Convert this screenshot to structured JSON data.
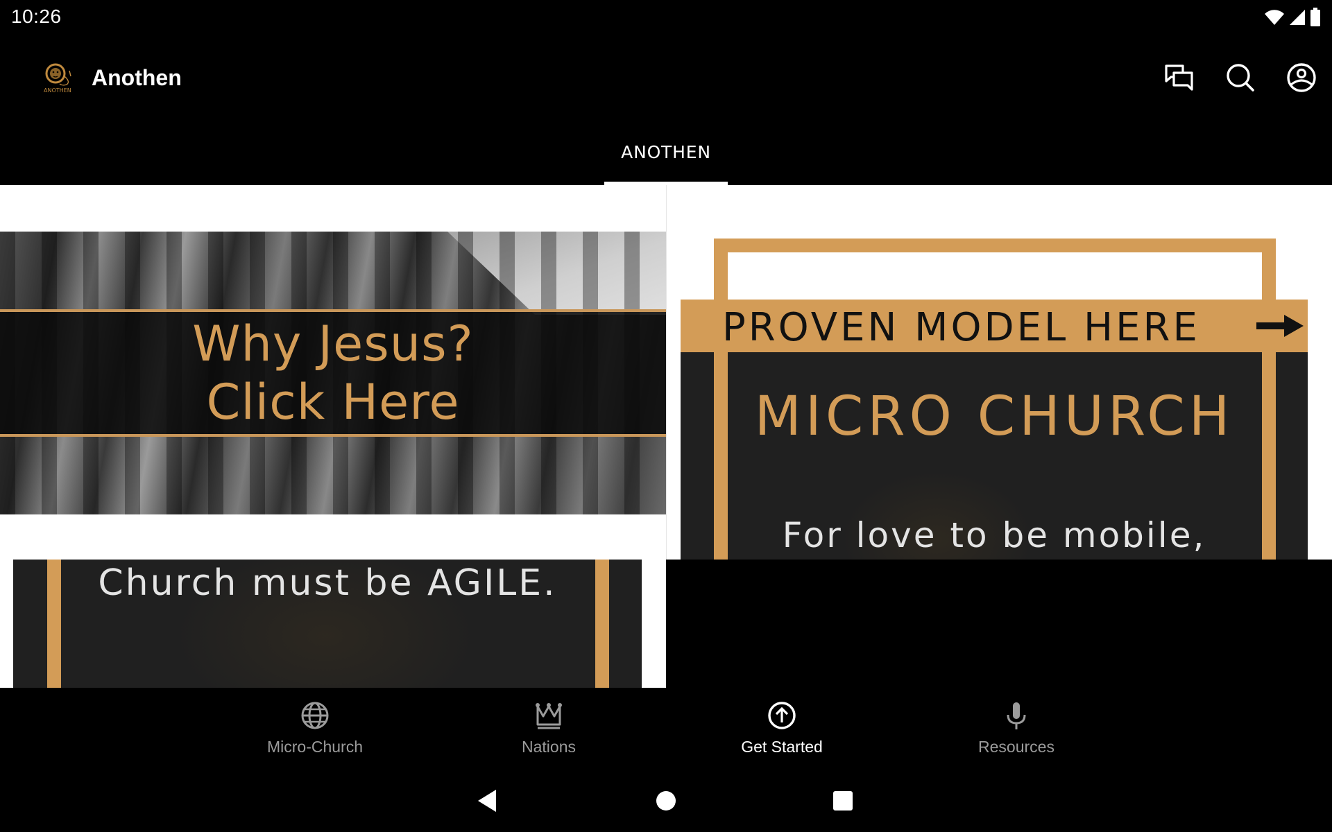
{
  "status_bar": {
    "time": "10:26",
    "icons": [
      "wifi-icon",
      "cellular-signal-icon",
      "battery-icon"
    ]
  },
  "app_bar": {
    "title": "Anothen",
    "logo": "anothen-lion-logo",
    "logo_caption": "ANOTHEN",
    "actions": [
      {
        "name": "chat",
        "icon": "chat-bubbles-icon"
      },
      {
        "name": "search",
        "icon": "search-icon"
      },
      {
        "name": "account",
        "icon": "account-circle-icon"
      }
    ]
  },
  "tabs": [
    {
      "label": "ANOTHEN",
      "selected": true
    }
  ],
  "content": {
    "why_jesus_banner": {
      "line1": "Why Jesus?",
      "line2": "Click Here"
    },
    "agile_card": {
      "text": "Church must be AGILE."
    },
    "micro_church_card": {
      "band_text": "PROVEN MODEL HERE",
      "title": "MICRO CHURCH",
      "subtitle": "For love to be mobile,"
    }
  },
  "bottom_nav": {
    "items": [
      {
        "label": "Micro-Church",
        "icon": "globe-icon",
        "active": false
      },
      {
        "label": "Nations",
        "icon": "crown-icon",
        "active": false
      },
      {
        "label": "Get Started",
        "icon": "arrow-up-circle-icon",
        "active": true
      },
      {
        "label": "Resources",
        "icon": "microphone-icon",
        "active": false
      }
    ]
  },
  "system_nav": {
    "buttons": [
      "back",
      "home",
      "recents"
    ]
  },
  "colors": {
    "accent_gold": "#d39c57",
    "card_dark": "#202020",
    "background": "#000000",
    "inactive_nav": "#9b9b9b"
  }
}
